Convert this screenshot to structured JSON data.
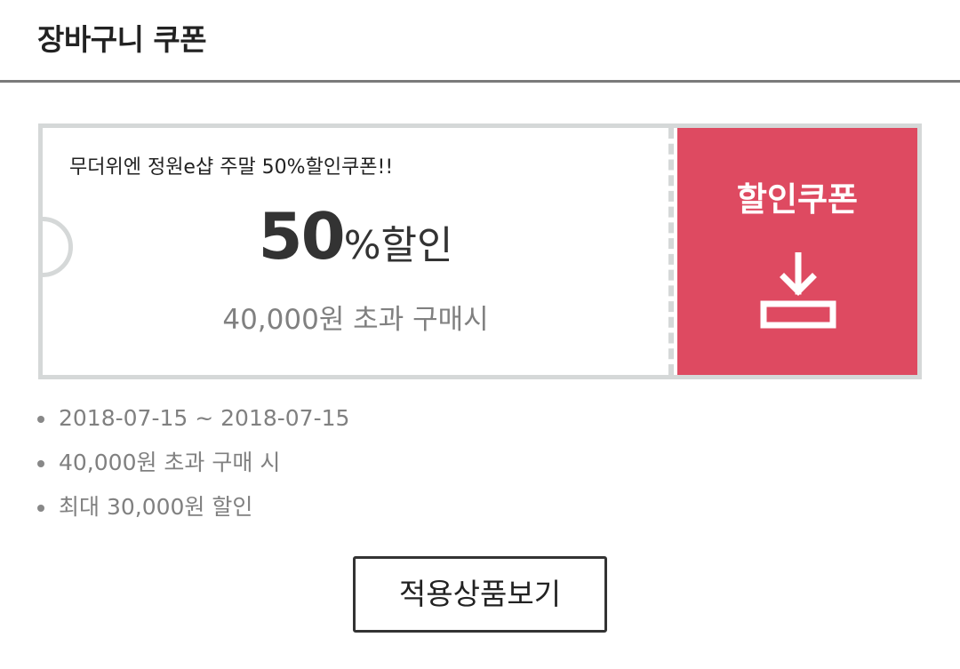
{
  "header": {
    "title": "장바구니 쿠폰"
  },
  "coupon": {
    "name": "무더위엔 정원e샵 주말 50%할인쿠폰!!",
    "discount_value": "50",
    "discount_unit": "%할인",
    "condition": "40,000원 초과 구매시",
    "action_label": "할인쿠폰",
    "action_icon": "download-icon",
    "accent_color": "#de4a61"
  },
  "details": {
    "period": "2018-07-15 ~ 2018-07-15",
    "minimum_purchase": "40,000원 초과 구매 시",
    "max_discount": "최대 30,000원 할인"
  },
  "apply_button": {
    "label": "적용상품보기"
  }
}
